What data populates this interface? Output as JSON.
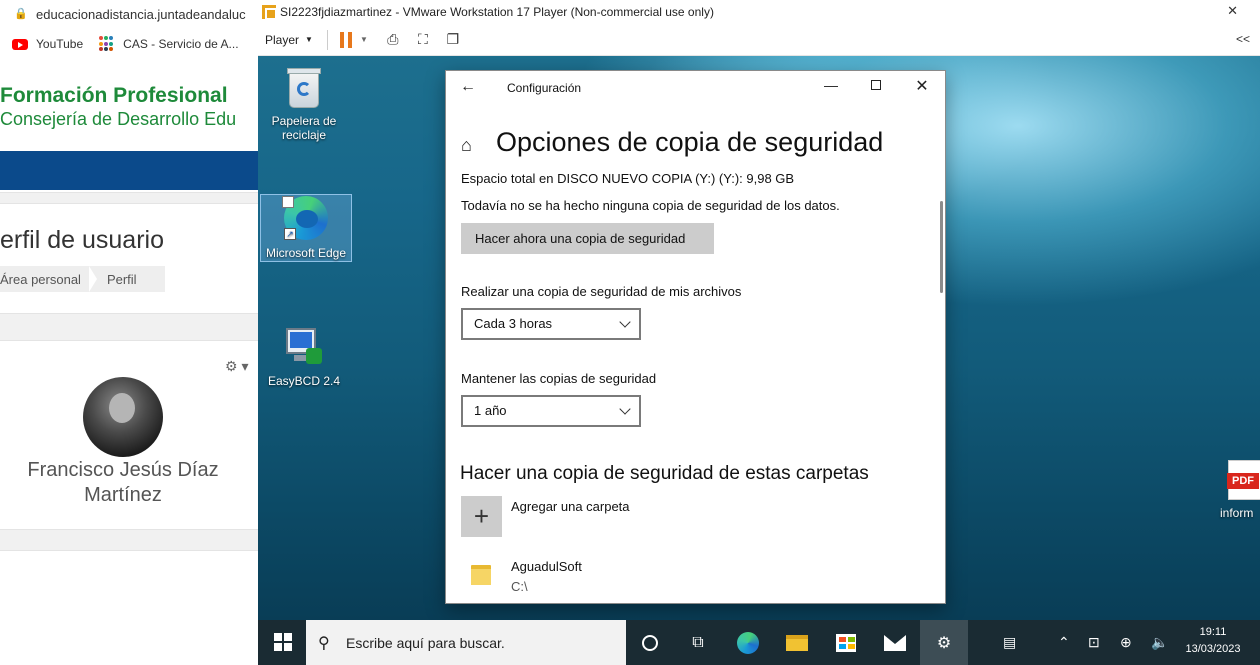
{
  "browser": {
    "url": "educacionadistancia.juntadeandaluc",
    "bookmarks": [
      {
        "label": "YouTube",
        "icon": "youtube-icon"
      },
      {
        "label": "CAS - Servicio de A...",
        "icon": "cas-icon"
      }
    ],
    "site_title": "Formación Profesional",
    "site_subtitle": "Consejería de Desarrollo Edu",
    "page_title": "erfil de usuario",
    "breadcrumb": [
      "Área personal",
      "Perfil"
    ],
    "user_name": "Francisco Jesús Díaz Martínez",
    "colors": {
      "brand_green": "#1e8a3a",
      "band_blue": "#0b4a8b"
    }
  },
  "vm": {
    "window_title": "SI2223fjdiazmartinez - VMware Workstation 17 Player (Non-commercial use only)",
    "player_label": "Player",
    "collapse_label": "<<"
  },
  "desktop": {
    "icons": [
      {
        "label": "Papelera de reciclaje",
        "icon": "recycle-bin-icon"
      },
      {
        "label": "Microsoft Edge",
        "icon": "edge-icon"
      },
      {
        "label": "EasyBCD 2.4",
        "icon": "easybcd-icon"
      },
      {
        "label": "inform",
        "icon": "pdf-icon"
      }
    ],
    "pdf_tag": "PDF"
  },
  "settings": {
    "window_title": "Configuración",
    "heading": "Opciones de copia de seguridad",
    "space_text": "Espacio total en DISCO NUEVO COPIA (Y:) (Y:): 9,98 GB",
    "status_text": "Todavía no se ha hecho ninguna copia de seguridad de los datos.",
    "backup_now_label": "Hacer ahora una copia de seguridad",
    "frequency_label": "Realizar una copia de seguridad de mis archivos",
    "frequency_value": "Cada 3 horas",
    "keep_label": "Mantener las copias de seguridad",
    "keep_value": "1 año",
    "folders_heading": "Hacer una copia de seguridad de estas carpetas",
    "add_folder_label": "Agregar una carpeta",
    "folders": [
      {
        "name": "AguadulSoft",
        "path": "C:\\"
      }
    ]
  },
  "taskbar": {
    "search_placeholder": "Escribe aquí para buscar.",
    "time": "19:11",
    "date": "13/03/2023"
  }
}
